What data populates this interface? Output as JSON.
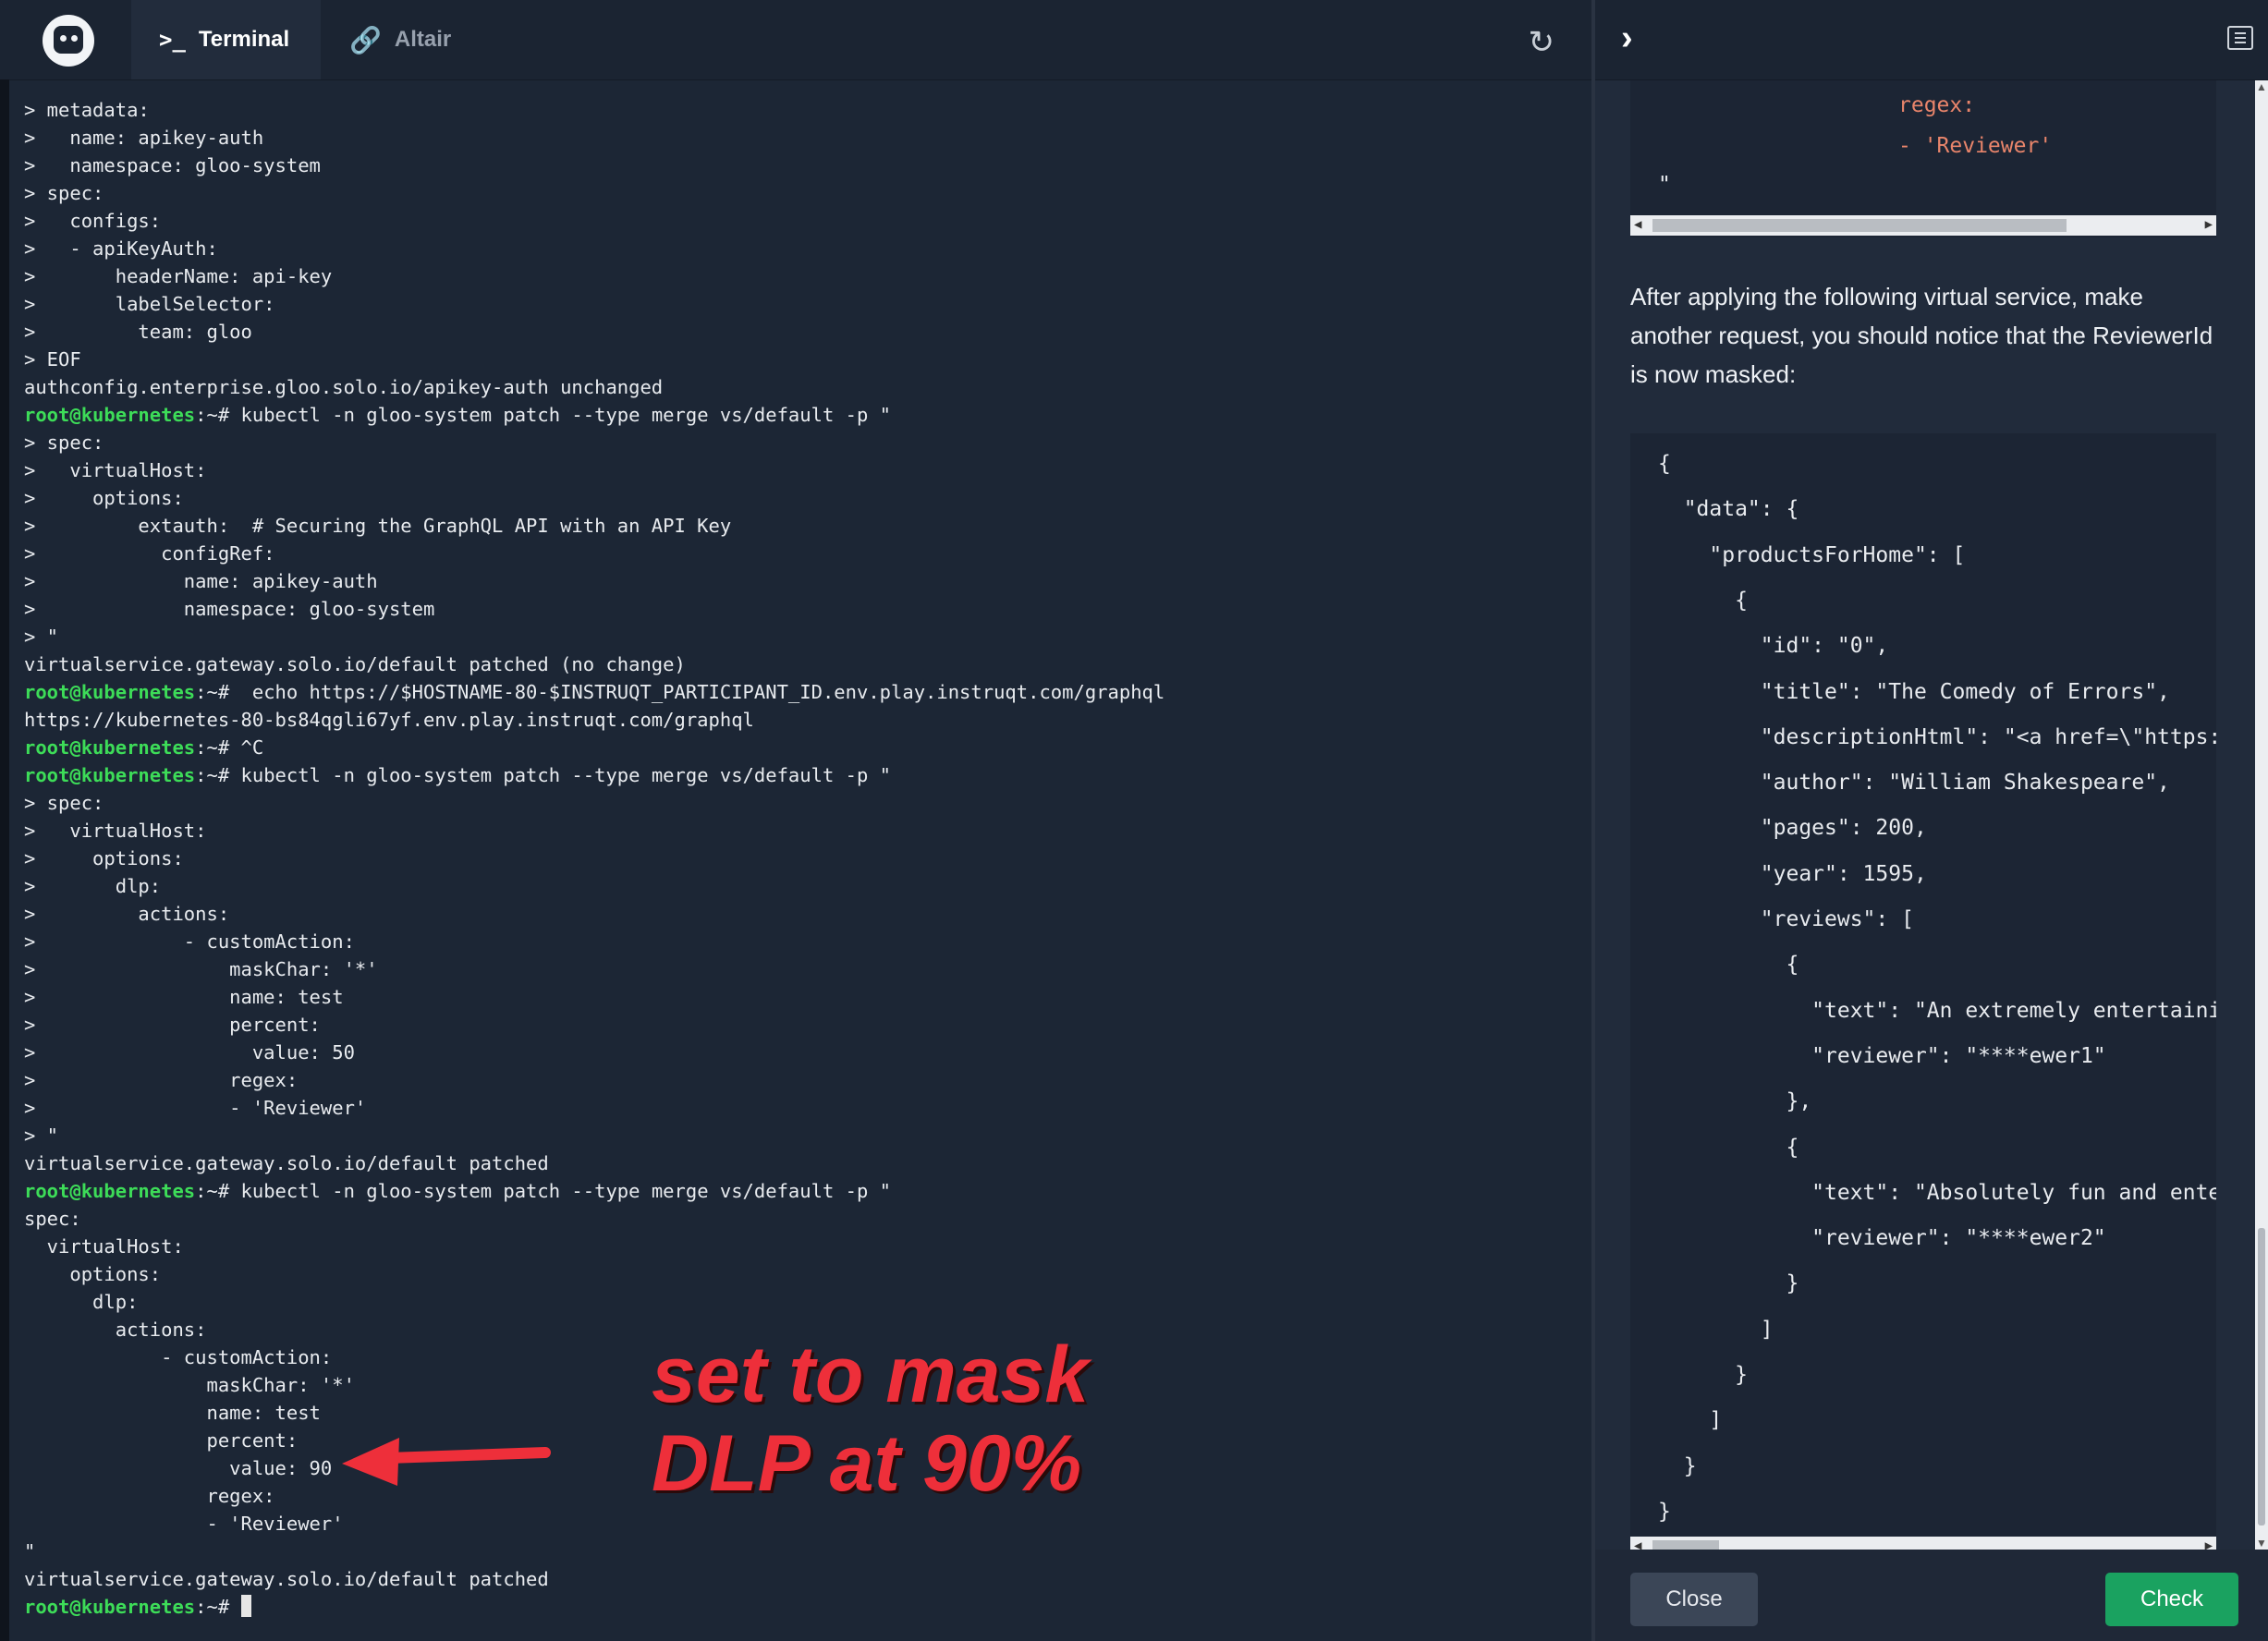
{
  "tabs": [
    {
      "label": "Terminal",
      "icon": "terminal-icon",
      "active": true
    },
    {
      "label": "Altair",
      "icon": "link-icon",
      "active": false
    }
  ],
  "terminal": {
    "lines": [
      {
        "prompt": "",
        "text": "> metadata:"
      },
      {
        "prompt": "",
        "text": ">   name: apikey-auth"
      },
      {
        "prompt": "",
        "text": ">   namespace: gloo-system"
      },
      {
        "prompt": "",
        "text": "> spec:"
      },
      {
        "prompt": "",
        "text": ">   configs:"
      },
      {
        "prompt": "",
        "text": ">   - apiKeyAuth:"
      },
      {
        "prompt": "",
        "text": ">       headerName: api-key"
      },
      {
        "prompt": "",
        "text": ">       labelSelector:"
      },
      {
        "prompt": "",
        "text": ">         team: gloo"
      },
      {
        "prompt": "",
        "text": "> EOF"
      },
      {
        "prompt": "",
        "text": "authconfig.enterprise.gloo.solo.io/apikey-auth unchanged"
      },
      {
        "prompt": "root@kubernetes",
        "text": ":~# kubectl -n gloo-system patch --type merge vs/default -p \""
      },
      {
        "prompt": "",
        "text": "> spec:"
      },
      {
        "prompt": "",
        "text": ">   virtualHost:"
      },
      {
        "prompt": "",
        "text": ">     options:"
      },
      {
        "prompt": "",
        "text": ">         extauth:  # Securing the GraphQL API with an API Key"
      },
      {
        "prompt": "",
        "text": ">           configRef:"
      },
      {
        "prompt": "",
        "text": ">             name: apikey-auth"
      },
      {
        "prompt": "",
        "text": ">             namespace: gloo-system"
      },
      {
        "prompt": "",
        "text": "> \""
      },
      {
        "prompt": "",
        "text": "virtualservice.gateway.solo.io/default patched (no change)"
      },
      {
        "prompt": "root@kubernetes",
        "text": ":~#  echo https://$HOSTNAME-80-$INSTRUQT_PARTICIPANT_ID.env.play.instruqt.com/graphql"
      },
      {
        "prompt": "",
        "text": "https://kubernetes-80-bs84qgli67yf.env.play.instruqt.com/graphql"
      },
      {
        "prompt": "root@kubernetes",
        "text": ":~# ^C"
      },
      {
        "prompt": "root@kubernetes",
        "text": ":~# kubectl -n gloo-system patch --type merge vs/default -p \""
      },
      {
        "prompt": "",
        "text": "> spec:"
      },
      {
        "prompt": "",
        "text": ">   virtualHost:"
      },
      {
        "prompt": "",
        "text": ">     options:"
      },
      {
        "prompt": "",
        "text": ">       dlp:"
      },
      {
        "prompt": "",
        "text": ">         actions:"
      },
      {
        "prompt": "",
        "text": ">             - customAction:"
      },
      {
        "prompt": "",
        "text": ">                 maskChar: '*'"
      },
      {
        "prompt": "",
        "text": ">                 name: test"
      },
      {
        "prompt": "",
        "text": ">                 percent:"
      },
      {
        "prompt": "",
        "text": ">                   value: 50"
      },
      {
        "prompt": "",
        "text": ">                 regex:"
      },
      {
        "prompt": "",
        "text": ">                 - 'Reviewer'"
      },
      {
        "prompt": "",
        "text": "> \""
      },
      {
        "prompt": "",
        "text": "virtualservice.gateway.solo.io/default patched"
      },
      {
        "prompt": "root@kubernetes",
        "text": ":~# kubectl -n gloo-system patch --type merge vs/default -p \""
      },
      {
        "prompt": "",
        "text": "spec:"
      },
      {
        "prompt": "",
        "text": "  virtualHost:"
      },
      {
        "prompt": "",
        "text": "    options:"
      },
      {
        "prompt": "",
        "text": "      dlp:"
      },
      {
        "prompt": "",
        "text": "        actions:"
      },
      {
        "prompt": "",
        "text": "            - customAction:"
      },
      {
        "prompt": "",
        "text": "                maskChar: '*'"
      },
      {
        "prompt": "",
        "text": "                name: test"
      },
      {
        "prompt": "",
        "text": "                percent:"
      },
      {
        "prompt": "",
        "text": "                  value: 90"
      },
      {
        "prompt": "",
        "text": "                regex:"
      },
      {
        "prompt": "",
        "text": "                - 'Reviewer'"
      },
      {
        "prompt": "",
        "text": "\""
      },
      {
        "prompt": "",
        "text": "virtualservice.gateway.solo.io/default patched"
      },
      {
        "prompt": "root@kubernetes",
        "text": ":~# ",
        "cursor": true
      }
    ]
  },
  "annotation": {
    "line1": "set to mask",
    "line2": "DLP at 90%",
    "color": "#ee2f3a"
  },
  "panel": {
    "code_top": {
      "lines": [
        "regex:",
        "- 'Reviewer'",
        "\""
      ]
    },
    "paragraph": "After applying the following virtual service, make another request, you should notice that the ReviewerId is now masked:",
    "json_lines": [
      "{",
      "  \"data\": {",
      "    \"productsForHome\": [",
      "      {",
      "        \"id\": \"0\",",
      "        \"title\": \"The Comedy of Errors\",",
      "        \"descriptionHtml\": \"<a href=\\\"https:",
      "        \"author\": \"William Shakespeare\",",
      "        \"pages\": 200,",
      "        \"year\": 1595,",
      "        \"reviews\": [",
      "          {",
      "            \"text\": \"An extremely entertaini",
      "            \"reviewer\": \"****ewer1\"",
      "          },",
      "          {",
      "            \"text\": \"Absolutely fun and ente",
      "            \"reviewer\": \"****ewer2\"",
      "          }",
      "        ]",
      "      }",
      "    ]",
      "  }",
      "}"
    ],
    "buttons": {
      "close": "Close",
      "check": "Check"
    }
  },
  "colors": {
    "terminal_bg": "#1c2635",
    "prompt_user": "#3ddc58",
    "check_button": "#1aa260",
    "yaml_key": "#e9856b"
  }
}
